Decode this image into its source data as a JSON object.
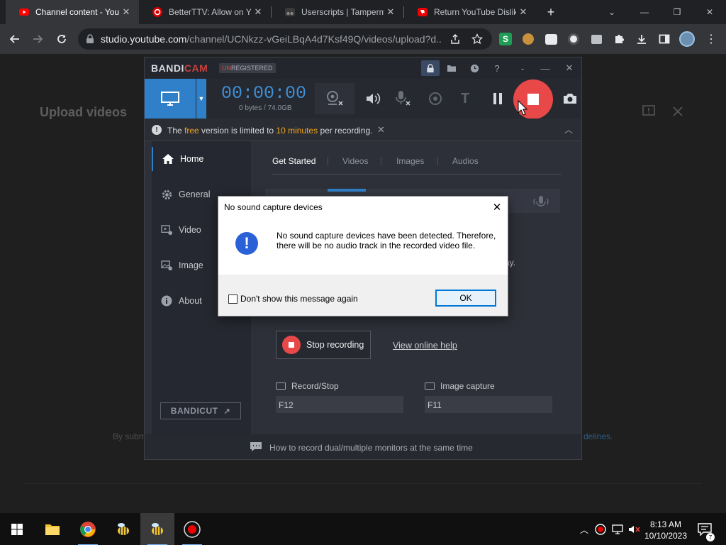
{
  "browser": {
    "tabs": [
      {
        "title": "Channel content - YouT",
        "active": true
      },
      {
        "title": "BetterTTV: Allow on Yo",
        "active": false
      },
      {
        "title": "Userscripts | Tampermo",
        "active": false
      },
      {
        "title": "Return YouTube Dislike",
        "active": false
      }
    ],
    "new_tab_label": "+",
    "address_bar": {
      "host": "studio.youtube.com",
      "path": "/channel/UCNkzz-vGeiLBqA4d7Ksf49Q/videos/upload?d..."
    }
  },
  "youtube": {
    "page_title": "Upload videos",
    "footer_text": "By subm",
    "footer_link": "delines."
  },
  "bandicam": {
    "logo_a": "BANDI",
    "logo_b": "CAM",
    "unreg_a": "UN",
    "unreg_b": "REGISTERED",
    "timer": "00:00:00",
    "bytes": "0 bytes / 74.0GB",
    "notice": {
      "prefix": "The ",
      "free": "free",
      "middle": " version is limited to ",
      "limit": "10 minutes",
      "suffix": " per recording."
    },
    "sidebar": [
      {
        "label": "Home",
        "icon": "home-icon"
      },
      {
        "label": "General",
        "icon": "gear-icon"
      },
      {
        "label": "Video",
        "icon": "video-settings-icon"
      },
      {
        "label": "Image",
        "icon": "image-settings-icon"
      },
      {
        "label": "About",
        "icon": "info-icon"
      }
    ],
    "bandicut": "BANDICUT",
    "content_tabs": [
      "Get Started",
      "Videos",
      "Images",
      "Audios"
    ],
    "partial_text": "ay.",
    "stop_recording": "Stop recording",
    "view_help": "View online help",
    "hotkeys": [
      {
        "label": "Record/Stop",
        "value": "F12"
      },
      {
        "label": "Image capture",
        "value": "F11"
      }
    ],
    "bottom_tip": "How to record dual/multiple monitors at the same time"
  },
  "dialog": {
    "title": "No sound capture devices",
    "message": "No sound capture devices have been detected. Therefore, there will be no audio track in the recorded video file.",
    "checkbox_label": "Don't show this message again",
    "ok_label": "OK"
  },
  "taskbar": {
    "time": "8:13 AM",
    "date": "10/10/2023",
    "notification_count": "7"
  },
  "colors": {
    "bandicam_blue": "#2f80c9",
    "record_red": "#e84848",
    "notice_orange": "#f2a51c"
  }
}
